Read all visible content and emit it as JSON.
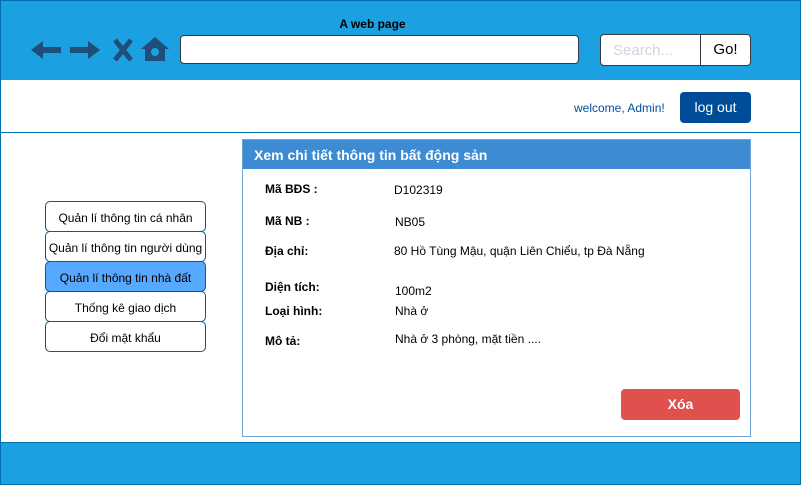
{
  "browser": {
    "title": "A web page",
    "url": "",
    "search_placeholder": "Search...",
    "go_label": "Go!",
    "icons": [
      "back-arrow-icon",
      "forward-arrow-icon",
      "close-icon",
      "home-icon"
    ]
  },
  "header": {
    "welcome": "welcome, Admin!",
    "logout_label": "log out"
  },
  "sidebar": {
    "items": [
      {
        "label": "Quản lí thông tin cá nhân",
        "active": false
      },
      {
        "label": "Quản lí thông tin người dùng",
        "active": false
      },
      {
        "label": "Quản lí thông tin nhà đất",
        "active": true
      },
      {
        "label": "Thống kê giao dịch",
        "active": false
      },
      {
        "label": "Đổi mật khẩu",
        "active": false
      }
    ]
  },
  "detail": {
    "title": "Xem chi tiết thông tin bất động sản",
    "fields": [
      {
        "label": "Mã BĐS :",
        "value": "D102319"
      },
      {
        "label": "Mã NB :",
        "value": "NB05"
      },
      {
        "label": "Địa chỉ:",
        "value": "80 Hồ Tùng Mậu, quận Liên Chiểu, tp Đà Nẵng"
      },
      {
        "label": "Diện tích:",
        "value": "100m2"
      },
      {
        "label": "Loại hình:",
        "value": "Nhà ở"
      },
      {
        "label": "Mô tả:",
        "value": "Nhà ở 3 phòng, mặt tiền ...."
      }
    ],
    "delete_label": "Xóa"
  },
  "colors": {
    "bar_blue": "#1ba1e2",
    "border_blue": "#006eaf",
    "logout_blue": "#004c99",
    "panel_header": "#3d8bd3",
    "menu_active": "#57a8ff",
    "delete_red": "#e0514e"
  }
}
